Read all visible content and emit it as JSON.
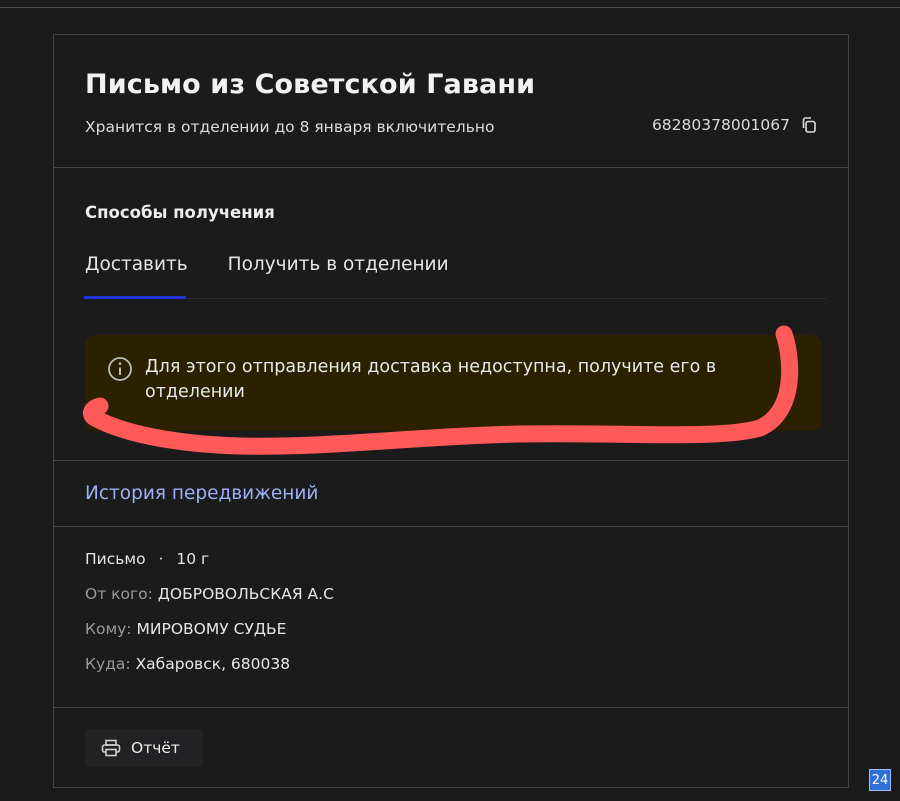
{
  "header": {
    "title": "Письмо из Советской Гавани",
    "storage_note": "Хранится в отделении до 8 января включительно",
    "tracking_number": "68280378001067"
  },
  "delivery": {
    "heading": "Способы получения",
    "tabs": [
      {
        "label": "Доставить",
        "active": true
      },
      {
        "label": "Получить в отделении",
        "active": false
      }
    ],
    "notice_text": "Для этого отправления доставка недоступна, получите его в отделении"
  },
  "history": {
    "link_label": "История передвижений"
  },
  "details": {
    "type": "Письмо",
    "separator": "·",
    "weight": "10 г",
    "from_label": "От кого:",
    "from_value": "ДОБРОВОЛЬСКАЯ А.С",
    "to_label": "Кому:",
    "to_value": "МИРОВОМУ СУДЬЕ",
    "where_label": "Куда:",
    "where_value": "Хабаровск, 680038"
  },
  "actions": {
    "report_label": "Отчёт"
  },
  "badge": {
    "text": "24"
  },
  "colors": {
    "background": "#1b1b1c",
    "accent_tab": "#1f35d6",
    "link": "#9cb0f5",
    "notice_bg": "#2b2100",
    "scribble": "#ff5a5a"
  },
  "icons": [
    "copy-icon",
    "info-icon",
    "printer-icon"
  ]
}
